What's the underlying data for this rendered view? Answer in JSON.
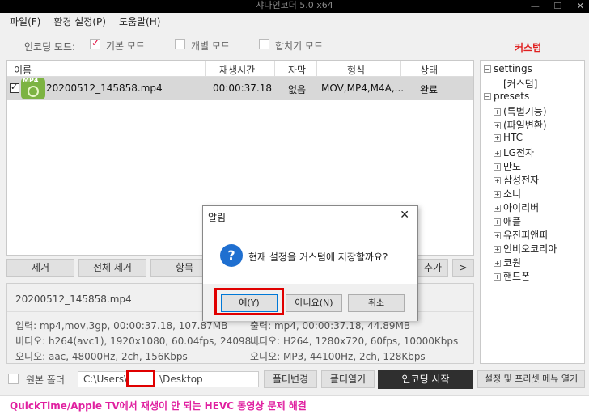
{
  "window": {
    "title": "샤나인코더 5.0 x64",
    "min": "—",
    "max": "❐",
    "close": "✕"
  },
  "menu": [
    "파일(F)",
    "환경 설정(P)",
    "도움말(H)"
  ],
  "mode": {
    "label": "인코딩 모드:",
    "options": [
      {
        "label": "기본 모드",
        "checked": true
      },
      {
        "label": "개별 모드",
        "checked": false
      },
      {
        "label": "합치기 모드",
        "checked": false
      }
    ]
  },
  "custom_label": "커스텀",
  "file_list": {
    "columns": [
      "이름",
      "재생시간",
      "자막",
      "형식",
      "상태"
    ],
    "rows": [
      {
        "checked": true,
        "icon": "mp4-file-icon",
        "icon_text": "MP4",
        "name": "20200512_145858.mp4",
        "duration": "00:00:37.18",
        "subtitle": "없음",
        "format": "MOV,MP4,M4A,...",
        "status": "완료"
      }
    ]
  },
  "buttons": {
    "remove": "제거",
    "remove_all": "전체 제거",
    "item": "항목",
    "add": "추가",
    "more": ">"
  },
  "info": {
    "filename": "20200512_145858.mp4",
    "input": "입력: mp4,mov,3gp, 00:00:37.18, 107.87MB",
    "video_in": "비디오: h264(avc1), 1920x1080, 60.04fps, 24098...",
    "audio_in": "오디오: aac, 48000Hz, 2ch, 156Kbps",
    "output": "출력: mp4, 00:00:37.18, 44.89MB",
    "video_out": "비디오: H264, 1280x720, 60fps, 10000Kbps",
    "audio_out": "오디오: MP3, 44100Hz, 2ch, 128Kbps"
  },
  "bottom": {
    "source_folder": "원본 폴더",
    "path_prefix": "C:\\Users\\",
    "path_suffix": "\\Desktop",
    "change_folder": "폴더변경",
    "open_folder": "폴더열기",
    "start": "인코딩 시작",
    "settings_menu": "설정 및 프리셋 메뉴 열기"
  },
  "status_text": "QuickTime/Apple TV에서 재생이 안 되는 HEVC 동영상 문제 해결",
  "tree": {
    "settings": "settings",
    "custom": "[커스텀]",
    "presets": "presets",
    "preset_items": [
      "(특별기능)",
      "(파일변환)",
      "HTC",
      "LG전자",
      "만도",
      "삼성전자",
      "소니",
      "아이리버",
      "애플",
      "유진피앤피",
      "인비오코리아",
      "코원",
      "핸드폰"
    ]
  },
  "dialog": {
    "title": "알림",
    "close": "✕",
    "message": "현재 설정을 커스텀에 저장할까요?",
    "yes": "예(Y)",
    "no": "아니요(N)",
    "cancel": "취소",
    "icon": "question-icon",
    "icon_glyph": "?"
  },
  "colors": {
    "accent_red": "#e02020",
    "status_pink": "#e020a0",
    "dialog_icon_blue": "#1f6fd0"
  }
}
